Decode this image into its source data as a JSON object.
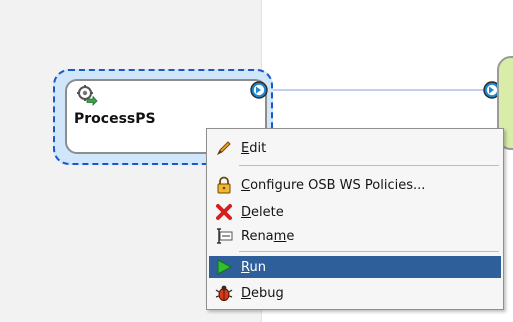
{
  "node": {
    "label": "ProcessPS",
    "icon": "gear-pipeline-icon"
  },
  "menu": {
    "items": [
      {
        "label": "Edit",
        "mnemonic_index": 0,
        "icon": "pencil-icon"
      },
      {
        "label": "Configure OSB WS Policies...",
        "mnemonic_index": 0,
        "icon": "lock-icon"
      },
      {
        "label": "Delete",
        "mnemonic_index": 0,
        "icon": "red-x-icon"
      },
      {
        "label": "Rename",
        "mnemonic_index": 4,
        "icon": "rename-icon"
      },
      {
        "label": "Run",
        "mnemonic_index": 0,
        "icon": "run-icon"
      },
      {
        "label": "Debug",
        "mnemonic_index": 0,
        "icon": "bug-icon"
      }
    ],
    "active_item": "Run"
  },
  "colors": {
    "selection": "#1c57c8",
    "menu_active": "#2f5f9a",
    "right_node_fill": "#d9eca8",
    "port": "#1e86d3"
  }
}
